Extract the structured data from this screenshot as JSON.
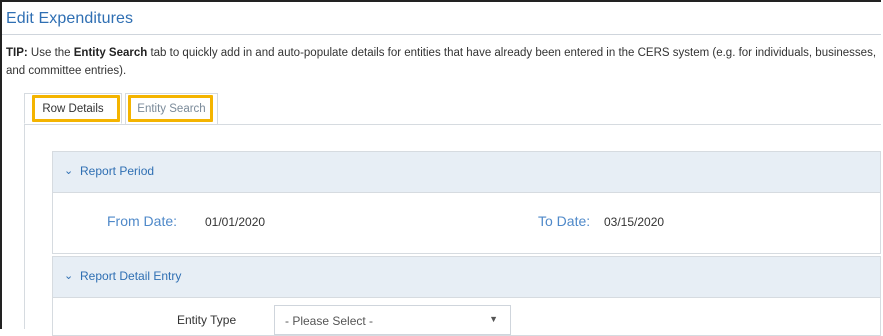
{
  "page": {
    "title": "Edit Expenditures"
  },
  "tip": {
    "prefix": "TIP:",
    "text_before": " Use the ",
    "highlight": "Entity Search",
    "text_after": " tab to quickly add in and auto-populate details for entities that have already been entered in the CERS system (e.g. for individuals, businesses, and committee entries)."
  },
  "tabs": [
    {
      "label": "Row Details",
      "active": true
    },
    {
      "label": "Entity Search",
      "active": false
    }
  ],
  "report_period": {
    "title": "Report Period",
    "from_label": "From Date:",
    "from_value": "01/01/2020",
    "to_label": "To Date:",
    "to_value": "03/15/2020"
  },
  "report_detail": {
    "title": "Report Detail Entry",
    "entity_type_label": "Entity Type",
    "entity_type_value": "- Please Select -"
  },
  "icons": {
    "section_collapse": "chevron-down-icon",
    "select_arrow": "caret-down-icon"
  },
  "colors": {
    "accent_blue": "#2f6fb3",
    "label_blue": "#4f89c9",
    "highlight_yellow": "#f4b400",
    "panel_header_bg": "#e7eef5"
  }
}
